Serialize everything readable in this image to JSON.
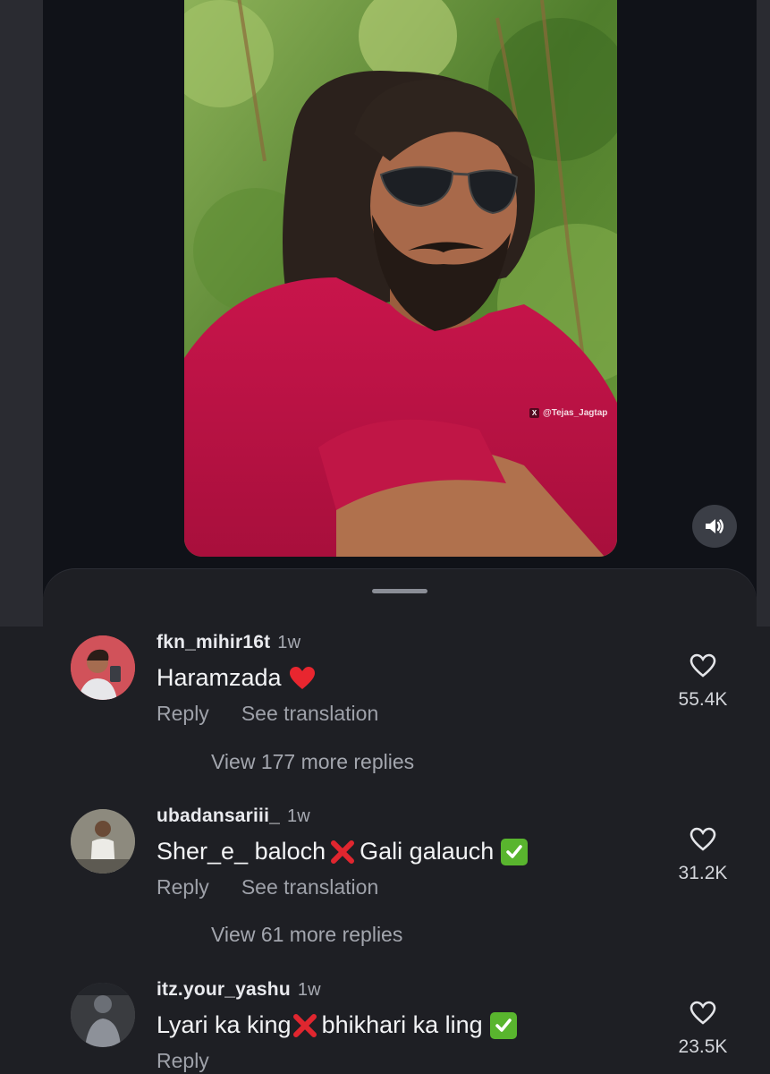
{
  "video": {
    "watermark_text": "@Tejas_Jagtap",
    "sound_icon": "speaker-icon"
  },
  "comments": [
    {
      "username": "fkn_mihir16t",
      "time": "1w",
      "text": "Haramzada",
      "text_suffix_icon": "red-heart-emoji",
      "reply_label": "Reply",
      "translate_label": "See translation",
      "likes": "55.4K",
      "view_replies": "View 177 more replies"
    },
    {
      "username": "ubadansariii_",
      "time": "1w",
      "text_part1": "Sher_e_ baloch",
      "text_part2": "Gali galauch",
      "reply_label": "Reply",
      "translate_label": "See translation",
      "likes": "31.2K",
      "view_replies": "View 61 more replies"
    },
    {
      "username": "itz.your_yashu",
      "time": "1w",
      "text_part1": "Lyari ka king",
      "text_part2": "bhikhari ka ling",
      "reply_label": "Reply",
      "likes": "23.5K"
    }
  ],
  "colors": {
    "background": "#1e1f24",
    "video_bg": "#101218",
    "text_primary": "#f2f3f5",
    "text_secondary": "#9ea1a9",
    "heart_red": "#e8262f",
    "x_red": "#e0262f",
    "check_green": "#59b52e"
  }
}
